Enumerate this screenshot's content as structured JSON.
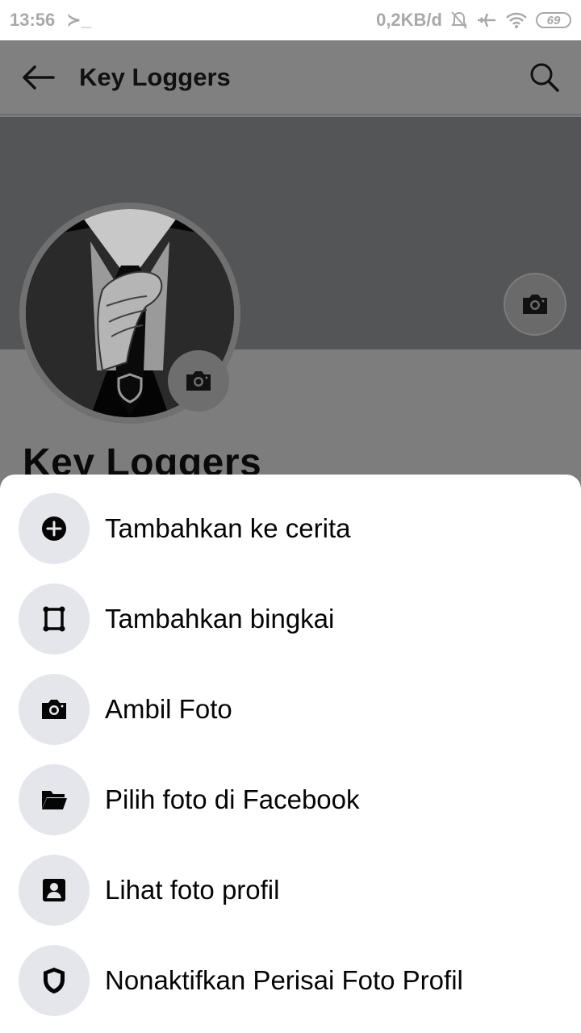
{
  "status_bar": {
    "time": "13:56",
    "terminal_glyph": "≻_",
    "data_rate": "0,2KB/d",
    "battery": "69"
  },
  "app_bar": {
    "title": "Key Loggers"
  },
  "profile": {
    "name": "Key Loggers"
  },
  "sheet": {
    "items": [
      {
        "label": "Tambahkan ke cerita",
        "icon": "plus-circle-icon"
      },
      {
        "label": "Tambahkan bingkai",
        "icon": "frame-icon"
      },
      {
        "label": "Ambil Foto",
        "icon": "camera-icon"
      },
      {
        "label": "Pilih foto di Facebook",
        "icon": "folder-icon"
      },
      {
        "label": "Lihat foto profil",
        "icon": "profile-card-icon"
      },
      {
        "label": "Nonaktifkan Perisai Foto Profil",
        "icon": "shield-icon"
      }
    ]
  },
  "colors": {
    "overlay": "#808080",
    "cover": "#545557",
    "sheet": "#ffffff",
    "menu_circle": "#e4e6eb"
  }
}
